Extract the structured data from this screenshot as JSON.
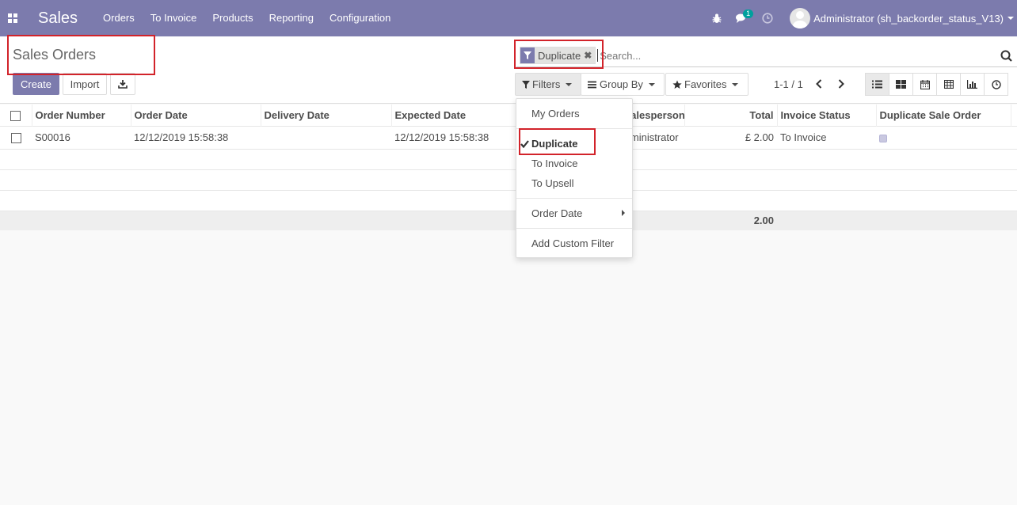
{
  "app": {
    "title": "Sales",
    "menu": [
      "Orders",
      "To Invoice",
      "Products",
      "Reporting",
      "Configuration"
    ],
    "messages_badge": "1",
    "user_name": "Administrator (sh_backorder_status_V13)"
  },
  "page": {
    "title": "Sales Orders",
    "create_label": "Create",
    "import_label": "Import"
  },
  "search": {
    "facet_label": "Duplicate",
    "placeholder": "Search..."
  },
  "filters": {
    "filters_label": "Filters",
    "group_by_label": "Group By",
    "favorites_label": "Favorites"
  },
  "pager": {
    "text": "1-1 / 1"
  },
  "table": {
    "columns": [
      "Order Number",
      "Order Date",
      "Delivery Date",
      "Expected Date",
      "Salesperson",
      "Total",
      "Invoice Status",
      "Duplicate Sale Order"
    ],
    "rows": [
      {
        "order_number": "S00016",
        "order_date": "12/12/2019 15:58:38",
        "delivery_date": "",
        "expected_date": "12/12/2019 15:58:38",
        "salesperson": "Administrator",
        "total": "£ 2.00",
        "invoice_status": "To Invoice",
        "duplicate": true
      }
    ],
    "footer_total": "2.00"
  },
  "dropdown": {
    "items": [
      "My Orders",
      "Duplicate",
      "To Invoice",
      "To Upsell",
      "Order Date",
      "Add Custom Filter"
    ],
    "selected": "Duplicate"
  },
  "colors": {
    "brand": "#7c7bad",
    "annotation": "#d2232a"
  }
}
